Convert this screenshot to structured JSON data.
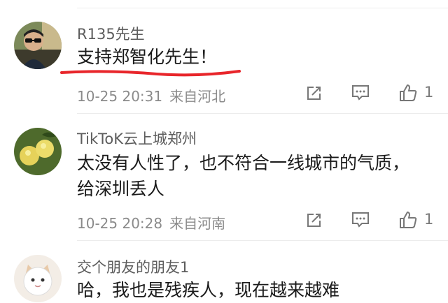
{
  "comments": [
    {
      "username": "R135先生",
      "content": "支持郑智化先生！",
      "date": "10-25 20:31",
      "location": "来自河北",
      "likes": "1",
      "avatar_icon": "person-sunglasses-avatar"
    },
    {
      "username": "TikToK云上城郑州",
      "content_line1": "太没有人性了，也不符合一线城市的气质，",
      "content_line2": "给深圳丢人",
      "date": "10-25 20:28",
      "location": "来自河南",
      "likes": "1",
      "avatar_icon": "lemons-avatar"
    },
    {
      "username": "交个朋友的朋友1",
      "content_partial": "哈，我也是残疾人，现在越来越难",
      "avatar_icon": "cat-avatar"
    }
  ],
  "icons": {
    "share": "share-icon",
    "comment": "comment-icon",
    "like": "thumbs-up-icon"
  },
  "colors": {
    "underline": "#e8262b",
    "text_primary": "#1a1a1a",
    "text_secondary": "#8a8a8a"
  }
}
